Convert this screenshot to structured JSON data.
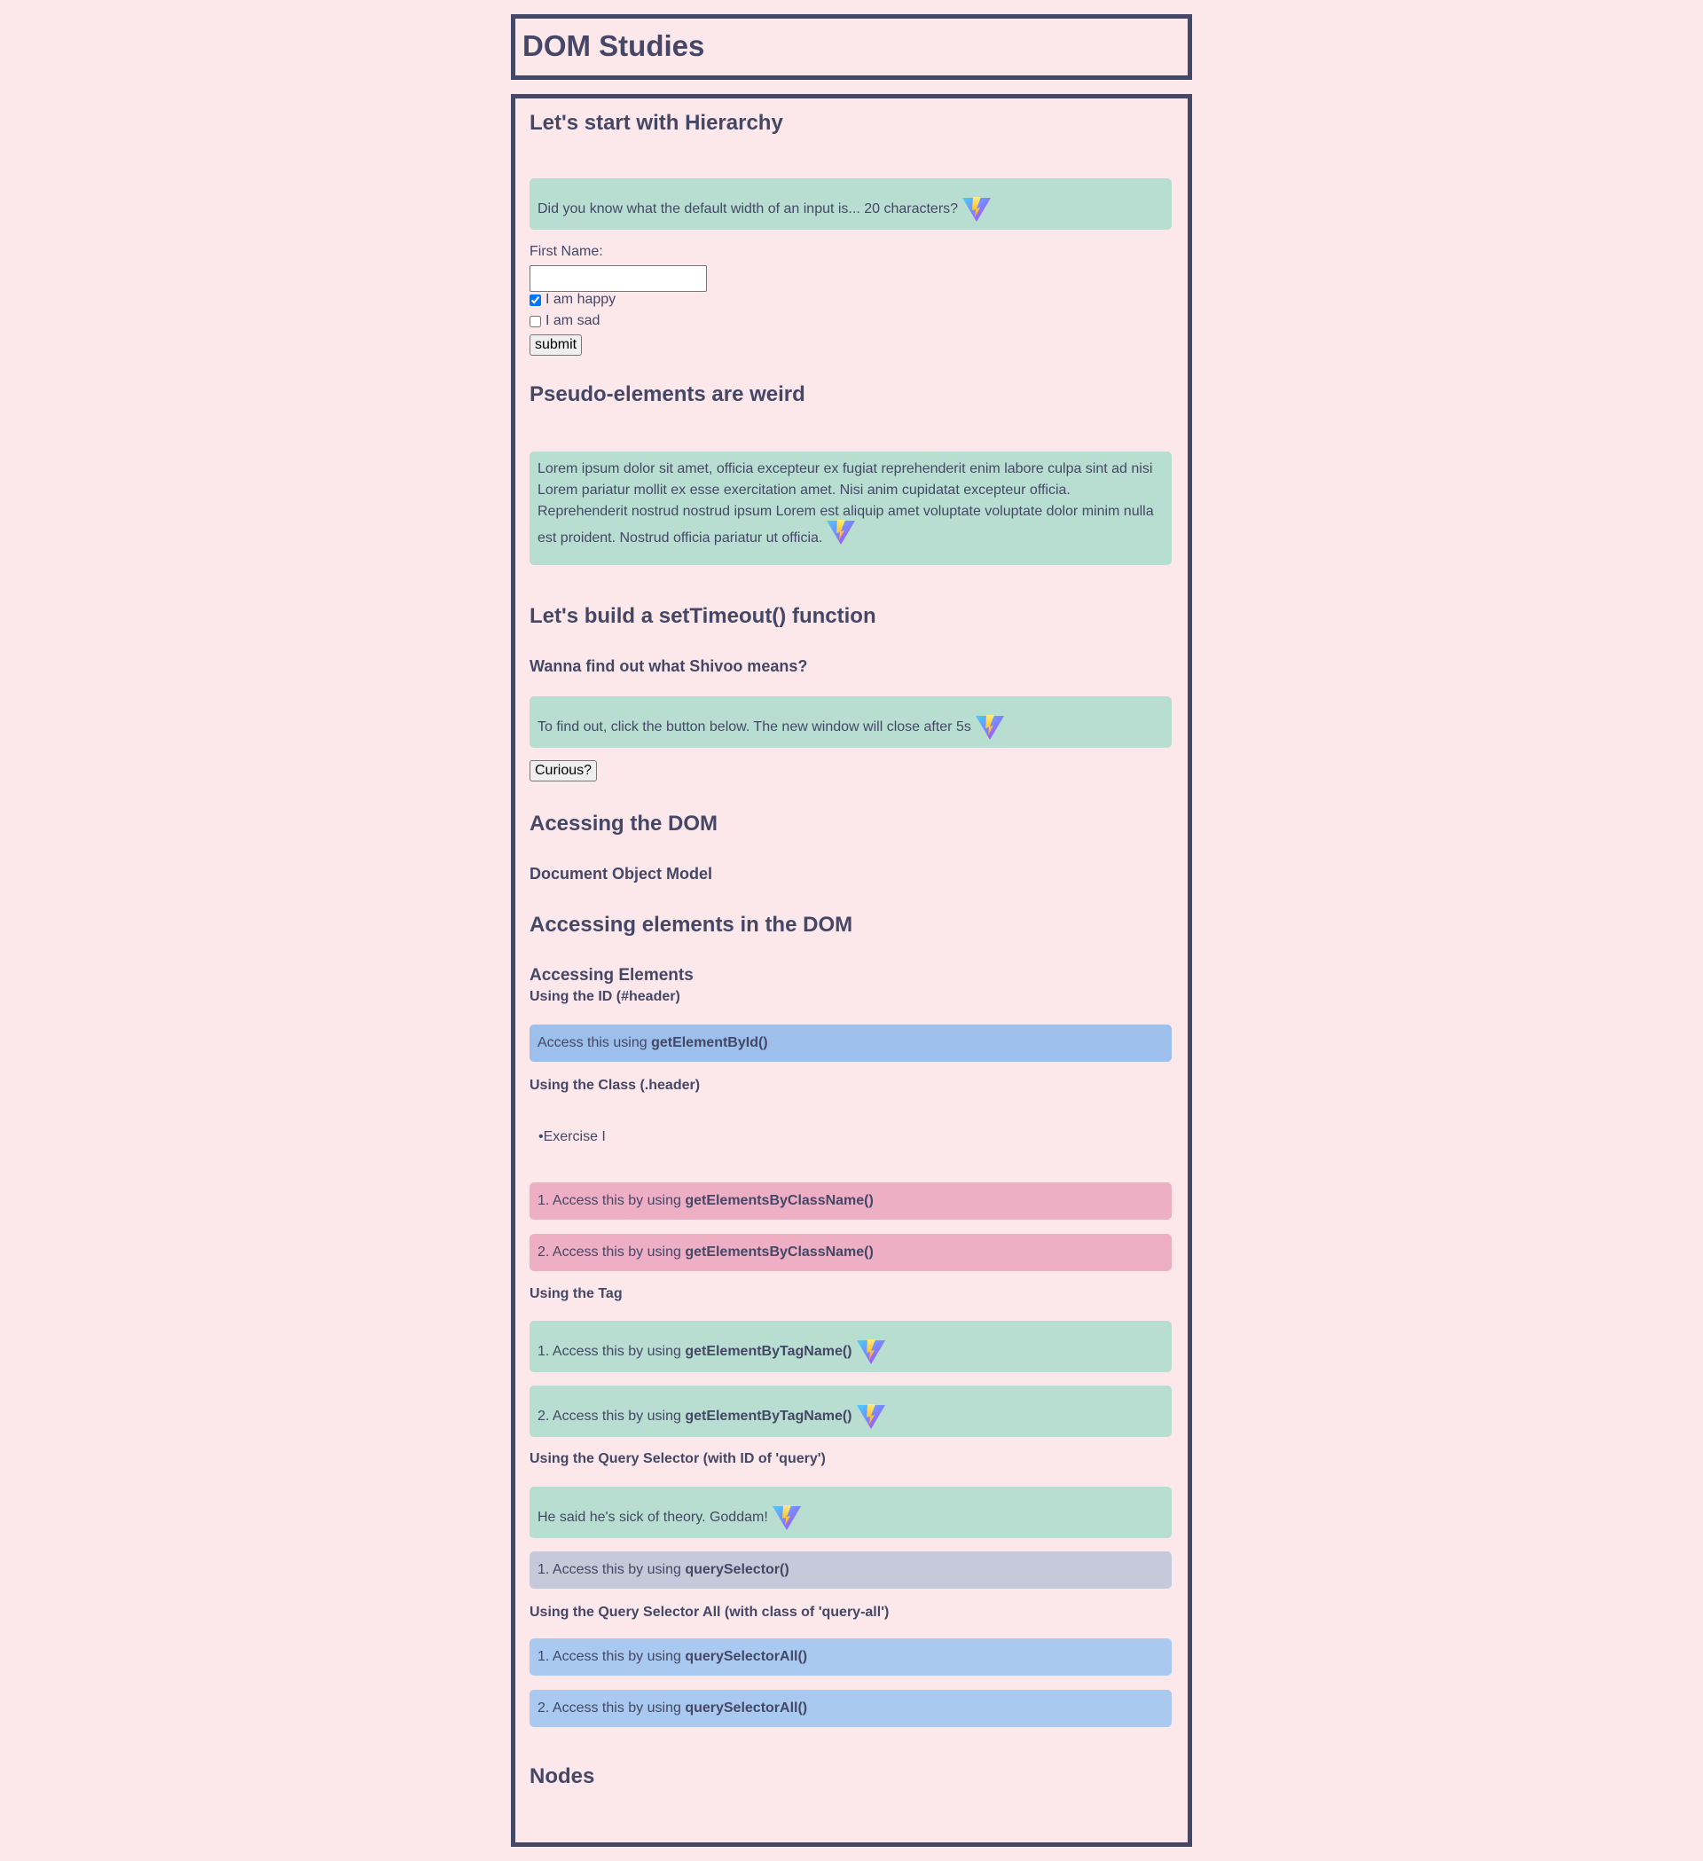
{
  "header": {
    "title": "DOM Studies"
  },
  "hierarchy": {
    "title": "Let's start with Hierarchy",
    "note": "Did you know what the default width of an input is... 20 characters?",
    "first_name_label": "First Name:",
    "first_name_value": "",
    "happy_label": "I am happy",
    "happy_checked": true,
    "sad_label": "I am sad",
    "sad_checked": false,
    "submit_label": "submit"
  },
  "pseudo": {
    "title": "Pseudo-elements are weird",
    "paragraph": "Lorem ipsum dolor sit amet, officia excepteur ex fugiat reprehenderit enim labore culpa sint ad nisi Lorem pariatur mollit ex esse exercitation amet. Nisi anim cupidatat excepteur officia. Reprehenderit nostrud nostrud ipsum Lorem est aliquip amet voluptate voluptate dolor minim nulla est proident. Nostrud officia pariatur ut officia."
  },
  "timeout": {
    "title": "Let's build a setTimeout() function",
    "subtitle": "Wanna find out what Shivoo means?",
    "note": "To find out, click the button below. The new window will close after 5s",
    "button_label": "Curious?"
  },
  "access": {
    "title": "Acessing the DOM",
    "subtitle": "Document Object Model"
  },
  "elements": {
    "title": "Accessing elements in the DOM",
    "subtitle": "Accessing Elements",
    "id_heading": "Using the ID (#header)",
    "id_prefix": "Access this using ",
    "id_method": "getElementById()",
    "class_heading": "Using the Class (.header)",
    "bullet": "Exercise I",
    "class_items": [
      {
        "prefix": "1. Access this by using ",
        "method": "getElementsByClassName()"
      },
      {
        "prefix": "2. Access this by using ",
        "method": "getElementsByClassName()"
      }
    ],
    "tag_heading": "Using the Tag",
    "tag_items": [
      {
        "prefix": "1. Access this by using ",
        "method": "getElementByTagName()"
      },
      {
        "prefix": "2. Access this by using ",
        "method": "getElementByTagName()"
      }
    ],
    "query_heading": "Using the Query Selector (with ID of 'query')",
    "query_note": "He said he's sick of theory. Goddam!",
    "query_item": {
      "prefix": "1. Access this by using ",
      "method": "querySelector()"
    },
    "query_all_heading": "Using the Query Selector All (with class of 'query-all')",
    "query_all_items": [
      {
        "prefix": "1. Access this by using ",
        "method": "querySelectorAll()"
      },
      {
        "prefix": "2. Access this by using ",
        "method": "querySelectorAll()"
      }
    ]
  },
  "nodes": {
    "title": "Nodes"
  },
  "colors": {
    "background": "#fce8ea",
    "text": "#454766",
    "green_box": "#b8ded1",
    "blue_box": "#9dbfec",
    "pink_box": "#eeafc4",
    "gray_box": "#c6c9d9",
    "light_blue_box": "#a9c9f1"
  },
  "icons": {
    "logo": "vite-logo-icon"
  }
}
